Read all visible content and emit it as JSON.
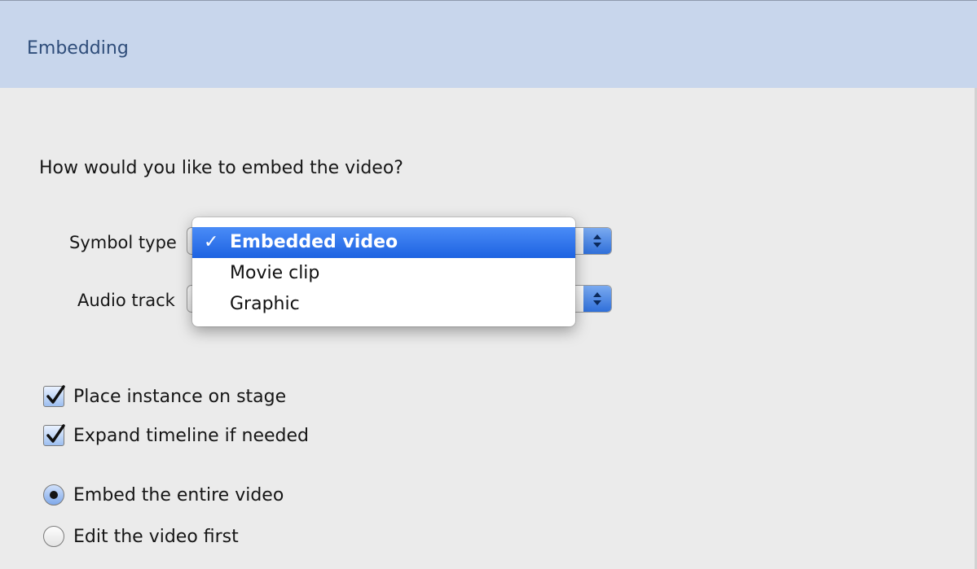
{
  "header": {
    "title": "Embedding"
  },
  "prompt": {
    "question": "How would you like to embed the video?"
  },
  "symbol_type": {
    "label": "Symbol type",
    "selected": "Embedded video",
    "options": [
      "Embedded video",
      "Movie clip",
      "Graphic"
    ],
    "check_glyph": "✓"
  },
  "audio_track": {
    "label": "Audio track"
  },
  "checkboxes": [
    {
      "label": "Place instance on stage",
      "checked": true
    },
    {
      "label": "Expand timeline if needed",
      "checked": true
    }
  ],
  "radios": [
    {
      "label": "Embed the entire video",
      "selected": true
    },
    {
      "label": "Edit the video first",
      "selected": false
    }
  ],
  "colors": {
    "header_bg": "#c8d6ec",
    "header_text": "#2f4d7a",
    "selection": "#1d62e1",
    "window_bg": "#ebebeb"
  }
}
